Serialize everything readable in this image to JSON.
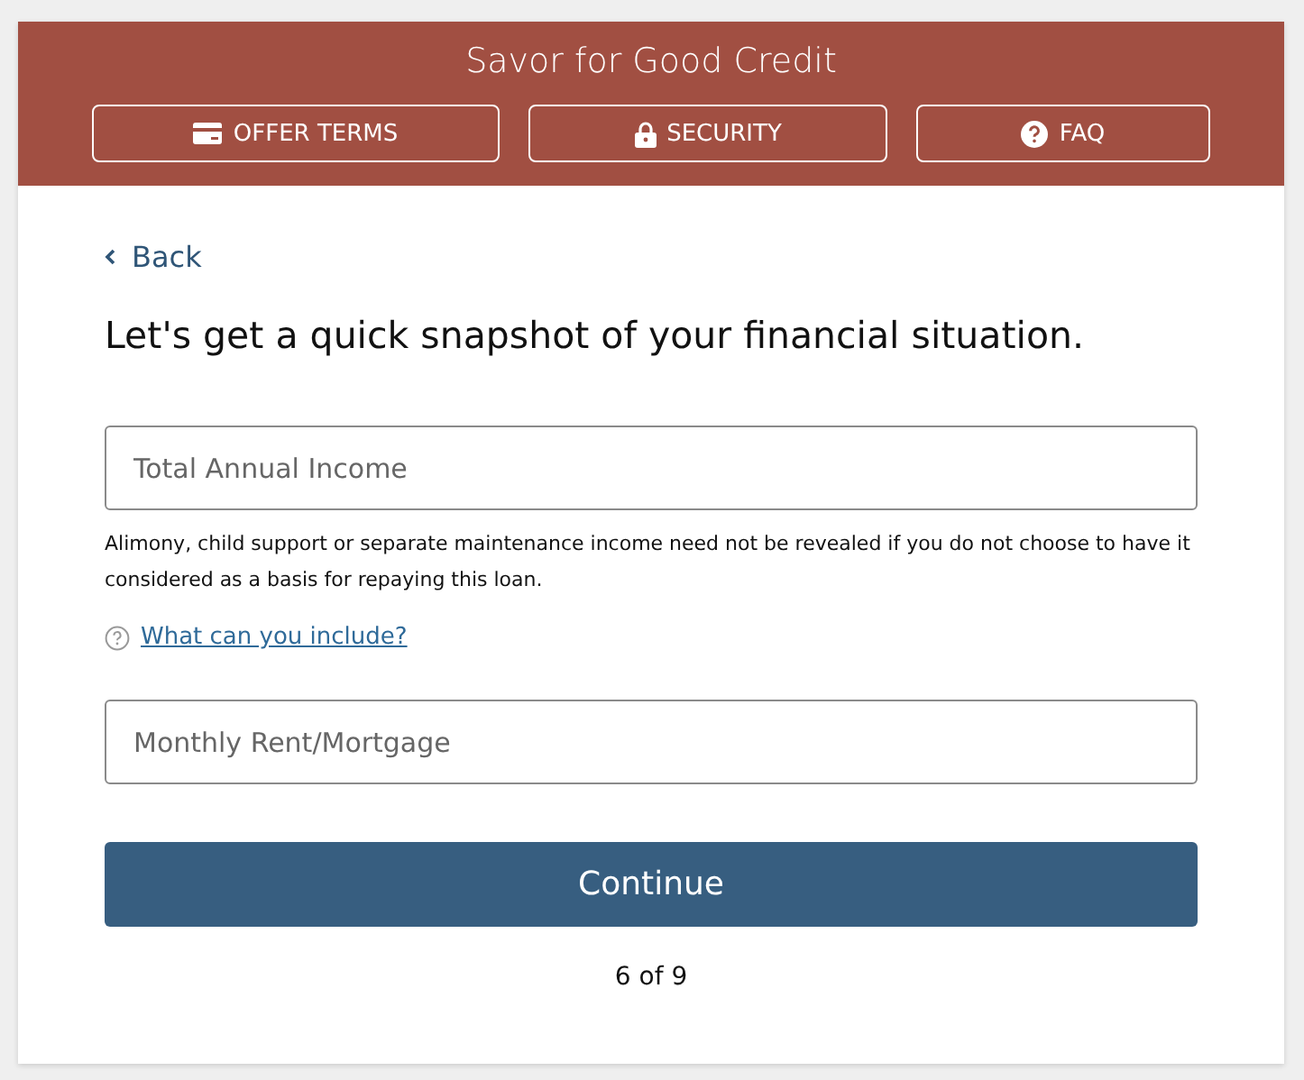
{
  "header": {
    "title": "Savor for Good Credit",
    "nav": [
      {
        "label": "OFFER TERMS",
        "kind": "card"
      },
      {
        "label": "SECURITY",
        "kind": "lock"
      },
      {
        "label": "FAQ",
        "kind": "help"
      }
    ]
  },
  "back": {
    "label": "Back"
  },
  "heading": "Let's get a quick snapshot of your financial situation.",
  "income_field": {
    "placeholder": "Total Annual Income"
  },
  "disclaimer": "Alimony, child support or separate maintenance income need not be revealed if you do not choose to have it considered as a basis for repaying this loan.",
  "help_link": "What can you include?",
  "rent_field": {
    "placeholder": "Monthly Rent/Mortgage"
  },
  "continue_button": "Continue",
  "progress": "6 of 9"
}
